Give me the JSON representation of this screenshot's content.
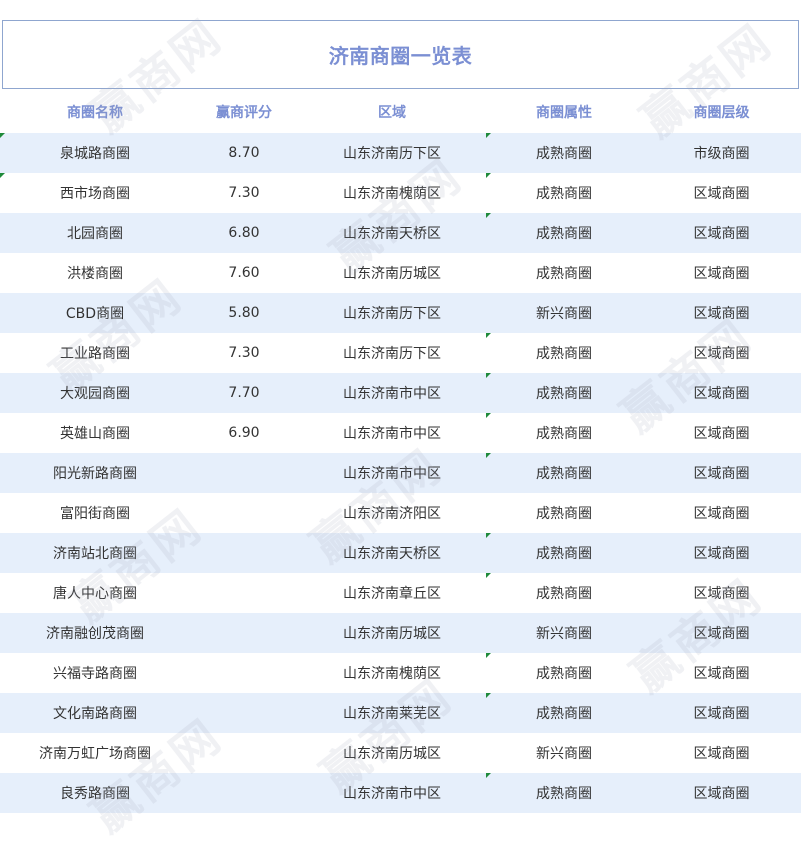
{
  "title": "济南商圈一览表",
  "columns": [
    "商圈名称",
    "赢商评分",
    "区域",
    "商圈属性",
    "商圈层级"
  ],
  "rows": [
    [
      "泉城路商圈",
      "8.70",
      "山东济南历下区",
      "成熟商圈",
      "市级商圈"
    ],
    [
      "西市场商圈",
      "7.30",
      "山东济南槐荫区",
      "成熟商圈",
      "区域商圈"
    ],
    [
      "北园商圈",
      "6.80",
      "山东济南天桥区",
      "成熟商圈",
      "区域商圈"
    ],
    [
      "洪楼商圈",
      "7.60",
      "山东济南历城区",
      "成熟商圈",
      "区域商圈"
    ],
    [
      "CBD商圈",
      "5.80",
      "山东济南历下区",
      "新兴商圈",
      "区域商圈"
    ],
    [
      "工业路商圈",
      "7.30",
      "山东济南历下区",
      "成熟商圈",
      "区域商圈"
    ],
    [
      "大观园商圈",
      "7.70",
      "山东济南市中区",
      "成熟商圈",
      "区域商圈"
    ],
    [
      "英雄山商圈",
      "6.90",
      "山东济南市中区",
      "成熟商圈",
      "区域商圈"
    ],
    [
      "阳光新路商圈",
      "",
      "山东济南市中区",
      "成熟商圈",
      "区域商圈"
    ],
    [
      "富阳街商圈",
      "",
      "山东济南济阳区",
      "成熟商圈",
      "区域商圈"
    ],
    [
      "济南站北商圈",
      "",
      "山东济南天桥区",
      "成熟商圈",
      "区域商圈"
    ],
    [
      "唐人中心商圈",
      "",
      "山东济南章丘区",
      "成熟商圈",
      "区域商圈"
    ],
    [
      "济南融创茂商圈",
      "",
      "山东济南历城区",
      "新兴商圈",
      "区域商圈"
    ],
    [
      "兴福寺路商圈",
      "",
      "山东济南槐荫区",
      "成熟商圈",
      "区域商圈"
    ],
    [
      "文化南路商圈",
      "",
      "山东济南莱芜区",
      "成熟商圈",
      "区域商圈"
    ],
    [
      "济南万虹广场商圈",
      "",
      "山东济南历城区",
      "新兴商圈",
      "区域商圈"
    ],
    [
      "良秀路商圈",
      "",
      "山东济南市中区",
      "成熟商圈",
      "区域商圈"
    ]
  ],
  "watermark_text": "赢商网",
  "colors": {
    "header_text": "#7b8fd3",
    "alt_row": "#e6effb",
    "border": "#8fa6cf"
  }
}
